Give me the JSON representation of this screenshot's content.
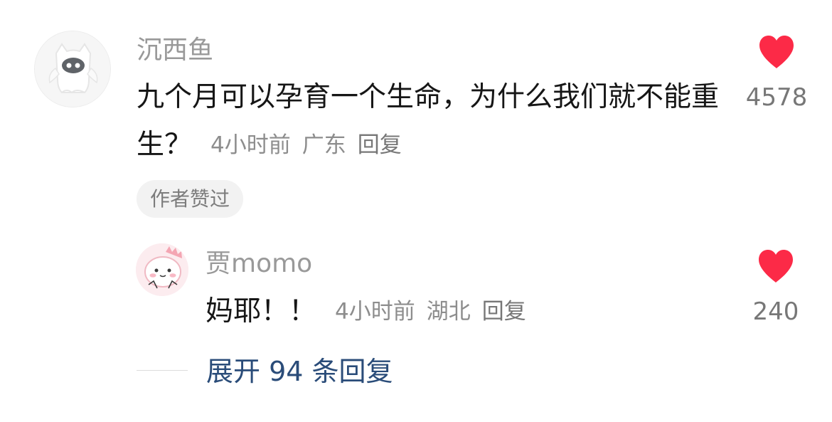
{
  "comment": {
    "username": "沉西鱼",
    "text": "九个月可以孕育一个生命，为什么我们就不能重生？",
    "time": "4小时前",
    "location": "广东",
    "reply_label": "回复",
    "author_badge": "作者赞过",
    "like_count": "4578"
  },
  "reply": {
    "username": "贾momo",
    "text": "妈耶！！",
    "time": "4小时前",
    "location": "湖北",
    "reply_label": "回复",
    "like_count": "240"
  },
  "expand": {
    "label": "展开 94 条回复"
  },
  "colors": {
    "heart": "#fc2a47",
    "link": "#2a4c79",
    "username": "#999999",
    "text": "#161616"
  },
  "icons": {
    "main_avatar": "ghost-cat-avatar",
    "reply_avatar": "pink-dinosaur-avatar",
    "like": "heart-icon"
  }
}
